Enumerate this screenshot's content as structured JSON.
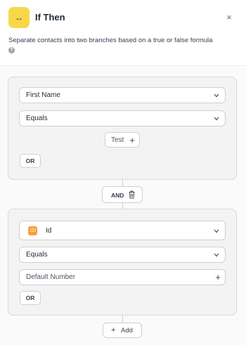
{
  "header": {
    "title": "If Then",
    "icon": "arrows-horizontal-icon",
    "icon_glyph": "↔",
    "close_glyph": "×",
    "description": "Separate contacts into two branches based on a true or false formula",
    "help_glyph": "?"
  },
  "colors": {
    "icon_bg": "#f7d84a",
    "group_bg": "#f3f3f3",
    "border": "#cfcfcf",
    "id_icon_bg": "#f59e3b"
  },
  "group1": {
    "field_select": "First Name",
    "operator_select": "Equals",
    "value_button": "Test",
    "or_label": "OR"
  },
  "connector": {
    "and_label": "AND"
  },
  "group2": {
    "field_select": "Id",
    "field_icon_glyph": "1D",
    "operator_select": "Equals",
    "value_placeholder": "Default Number",
    "or_label": "OR"
  },
  "footer": {
    "add_label": "Add",
    "add_glyph": "+"
  }
}
